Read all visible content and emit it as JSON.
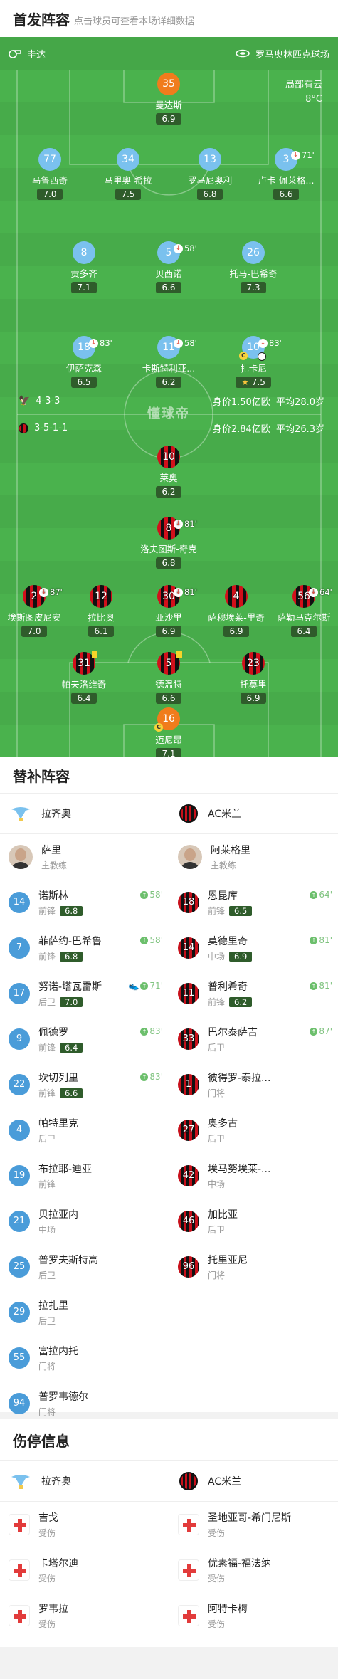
{
  "header": {
    "title": "首发阵容",
    "hint": "点击球员可查看本场详细数据"
  },
  "venue": {
    "left_icon": "whistle-icon",
    "referee": "圭达",
    "right_icon": "stadium-icon",
    "stadium": "罗马奥林匹克球场"
  },
  "weather": {
    "condition": "局部有云",
    "temp": "8°C"
  },
  "watermark": "懂球帝",
  "home_formation": {
    "team_icon": "lazio-logo",
    "formation": "4-3-3",
    "value": "身价1.50亿欧",
    "age": "平均28.0岁"
  },
  "away_formation": {
    "team_icon": "acmilan-logo",
    "formation": "3-5-1-1",
    "value": "身价2.84亿欧",
    "age": "平均26.3岁"
  },
  "home_players": [
    {
      "no": "35",
      "name": "曼达斯",
      "rating": "6.9",
      "gk": true
    },
    {
      "no": "77",
      "name": "马鲁西奇",
      "rating": "7.0"
    },
    {
      "no": "34",
      "name": "马里奥-希拉",
      "rating": "7.5"
    },
    {
      "no": "13",
      "name": "罗马尼奥利",
      "rating": "6.8"
    },
    {
      "no": "3",
      "name": "卢卡-佩莱格...",
      "rating": "6.6",
      "sub": "71'"
    },
    {
      "no": "8",
      "name": "贡多齐",
      "rating": "7.1"
    },
    {
      "no": "5",
      "name": "贝西诺",
      "rating": "6.6",
      "sub": "58'"
    },
    {
      "no": "26",
      "name": "托马-巴希奇",
      "rating": "7.3"
    },
    {
      "no": "18",
      "name": "伊萨克森",
      "rating": "6.5",
      "sub": "83'"
    },
    {
      "no": "11",
      "name": "卡斯特利亚...",
      "rating": "6.2",
      "sub": "58'"
    },
    {
      "no": "10",
      "name": "扎卡尼",
      "rating": "7.5",
      "sub": "83'",
      "captain": "C",
      "goal": true,
      "best": true
    }
  ],
  "away_players": [
    {
      "no": "10",
      "name": "莱奥",
      "rating": "6.2"
    },
    {
      "no": "8",
      "name": "洛夫图斯-奇克",
      "rating": "6.8",
      "sub": "81'"
    },
    {
      "no": "2",
      "name": "埃斯图皮尼安",
      "rating": "7.0",
      "sub": "87'"
    },
    {
      "no": "12",
      "name": "拉比奥",
      "rating": "6.1"
    },
    {
      "no": "30",
      "name": "亚沙里",
      "rating": "6.9",
      "sub": "81'"
    },
    {
      "no": "4",
      "name": "萨穆埃莱-里奇",
      "rating": "6.9"
    },
    {
      "no": "56",
      "name": "萨勒马克尔斯",
      "rating": "6.4",
      "sub": "64'"
    },
    {
      "no": "31",
      "name": "帕夫洛维奇",
      "rating": "6.4",
      "yellow": true
    },
    {
      "no": "5",
      "name": "德温特",
      "rating": "6.6",
      "yellow": true
    },
    {
      "no": "23",
      "name": "托莫里",
      "rating": "6.9"
    },
    {
      "no": "16",
      "name": "迈尼昂",
      "rating": "7.1",
      "gk": true,
      "captain": "C"
    }
  ],
  "subs": {
    "title": "替补阵容",
    "home_team": "拉齐奥",
    "away_team": "AC米兰",
    "home_coach": {
      "name": "萨里",
      "role": "主教练"
    },
    "away_coach": {
      "name": "阿莱格里",
      "role": "主教练"
    },
    "home": [
      {
        "no": "14",
        "name": "诺斯林",
        "pos": "前锋",
        "rating": "6.8",
        "in": "58'"
      },
      {
        "no": "7",
        "name": "菲萨约-巴希鲁",
        "pos": "前锋",
        "rating": "6.8",
        "in": "58'"
      },
      {
        "no": "17",
        "name": "努诺-塔瓦雷斯",
        "pos": "后卫",
        "rating": "7.0",
        "in": "71'",
        "assist": true
      },
      {
        "no": "9",
        "name": "佩德罗",
        "pos": "前锋",
        "rating": "6.4",
        "in": "83'"
      },
      {
        "no": "22",
        "name": "坎切列里",
        "pos": "前锋",
        "rating": "6.6",
        "in": "83'"
      },
      {
        "no": "4",
        "name": "帕特里克",
        "pos": "后卫"
      },
      {
        "no": "19",
        "name": "布拉耶-迪亚",
        "pos": "前锋"
      },
      {
        "no": "21",
        "name": "贝拉亚内",
        "pos": "中场"
      },
      {
        "no": "25",
        "name": "普罗夫斯特高",
        "pos": "后卫"
      },
      {
        "no": "29",
        "name": "拉扎里",
        "pos": "后卫"
      },
      {
        "no": "55",
        "name": "富拉内托",
        "pos": "门将"
      },
      {
        "no": "94",
        "name": "普罗韦德尔",
        "pos": "门将"
      }
    ],
    "away": [
      {
        "no": "18",
        "name": "恩昆库",
        "pos": "前锋",
        "rating": "6.5",
        "in": "64'"
      },
      {
        "no": "14",
        "name": "莫德里奇",
        "pos": "中场",
        "rating": "6.9",
        "in": "81'"
      },
      {
        "no": "11",
        "name": "普利希奇",
        "pos": "前锋",
        "rating": "6.2",
        "in": "81'"
      },
      {
        "no": "33",
        "name": "巴尔泰萨吉",
        "pos": "后卫",
        "in": "87'"
      },
      {
        "no": "1",
        "name": "彼得罗-泰拉...",
        "pos": "门将"
      },
      {
        "no": "27",
        "name": "奥多古",
        "pos": "后卫"
      },
      {
        "no": "42",
        "name": "埃马努埃莱-...",
        "pos": "中场"
      },
      {
        "no": "46",
        "name": "加比亚",
        "pos": "后卫"
      },
      {
        "no": "96",
        "name": "托里亚尼",
        "pos": "门将"
      }
    ]
  },
  "injuries": {
    "title": "伤停信息",
    "home_team": "拉齐奥",
    "away_team": "AC米兰",
    "home": [
      {
        "name": "吉戈",
        "status": "受伤"
      },
      {
        "name": "卡塔尔迪",
        "status": "受伤"
      },
      {
        "name": "罗韦拉",
        "status": "受伤"
      }
    ],
    "away": [
      {
        "name": "圣地亚哥-希门尼斯",
        "status": "受伤"
      },
      {
        "name": "优素福-福法纳",
        "status": "受伤"
      },
      {
        "name": "阿特卡梅",
        "status": "受伤"
      }
    ]
  }
}
